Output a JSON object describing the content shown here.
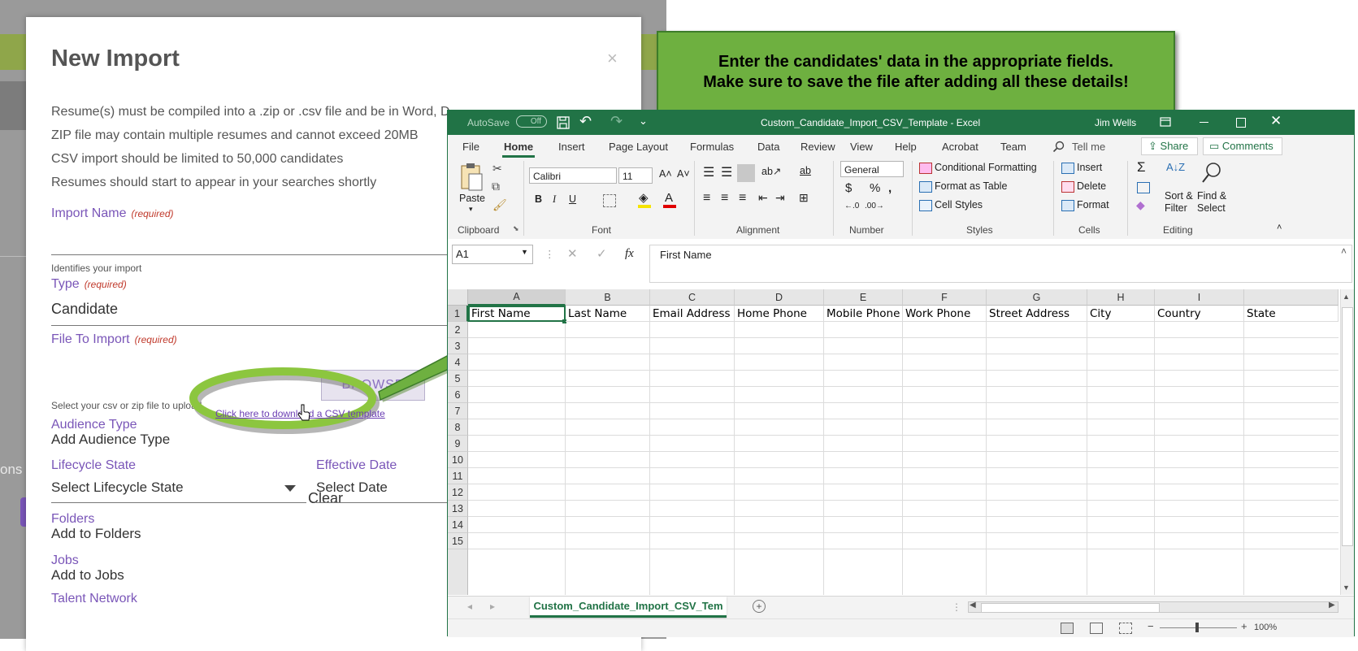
{
  "bg": {
    "fragment": "ons"
  },
  "modal": {
    "title": "New Import",
    "close": "×",
    "info": [
      "Resume(s) must be compiled into a .zip or .csv file and be in Word, D",
      "ZIP file may contain multiple resumes and cannot exceed 20MB",
      "CSV import should be limited to 50,000 candidates",
      "Resumes should start to appear in your searches shortly"
    ],
    "required": "(required)",
    "import_name_label": "Import Name",
    "import_name_hint": "Identifies your import",
    "type_label": "Type",
    "type_value": "Candidate",
    "file_label": "File To Import",
    "browse": "BROWSE",
    "upload_hint": "Select your csv or zip file to upload.",
    "csv_link": "Click here to download a CSV template",
    "audience_label": "Audience Type",
    "audience_value": "Add Audience Type",
    "lifecycle_label": "Lifecycle State",
    "lifecycle_value": "Select Lifecycle State",
    "clear": "Clear",
    "effective_label": "Effective Date",
    "effective_value": "Select Date",
    "folders_label": "Folders",
    "folders_value": "Add to Folders",
    "jobs_label": "Jobs",
    "jobs_value": "Add to Jobs",
    "talent_label": "Talent Network"
  },
  "callout": {
    "line1": "Enter the candidates' data in the appropriate fields.",
    "line2": "Make sure to save the file after adding all these details!",
    "colors": {
      "fill": "#6eb040",
      "border": "#3d7c2a",
      "arrow": "#6eb040"
    }
  },
  "excel": {
    "autosave": "AutoSave",
    "autosave_state": "Off",
    "title": "Custom_Candidate_Import_CSV_Template - Excel",
    "user": "Jim Wells",
    "tabs": [
      "File",
      "Home",
      "Insert",
      "Page Layout",
      "Formulas",
      "Data",
      "Review",
      "View",
      "Help",
      "Acrobat",
      "Team"
    ],
    "tell_me": "Tell me",
    "share": "Share",
    "comments": "Comments",
    "clipboard": {
      "paste": "Paste",
      "label": "Clipboard"
    },
    "font": {
      "name": "Calibri",
      "size": "11",
      "label": "Font"
    },
    "alignment_label": "Alignment",
    "number": {
      "format": "General",
      "label": "Number"
    },
    "styles": {
      "cond": "Conditional Formatting",
      "table": "Format as Table",
      "cellstyles": "Cell Styles",
      "label": "Styles"
    },
    "cells": {
      "insert": "Insert",
      "delete": "Delete",
      "format": "Format",
      "label": "Cells"
    },
    "editing": {
      "sort1": "Sort &",
      "sort2": "Filter",
      "find1": "Find &",
      "find2": "Select",
      "label": "Editing"
    },
    "namebox": "A1",
    "formula": "First Name",
    "columns": [
      "A",
      "B",
      "C",
      "D",
      "E",
      "F",
      "G",
      "H",
      "I"
    ],
    "rows": [
      "1",
      "2",
      "3",
      "4",
      "5",
      "6",
      "7",
      "8",
      "9",
      "10",
      "11",
      "12",
      "13",
      "14",
      "15"
    ],
    "headers": [
      "First Name",
      "Last Name",
      "Email Address",
      "Home Phone",
      "Mobile Phone",
      "Work Phone",
      "Street Address",
      "City",
      "Country",
      "State"
    ],
    "sheet_tab": "Custom_Candidate_Import_CSV_Tem",
    "zoom": "100%"
  }
}
